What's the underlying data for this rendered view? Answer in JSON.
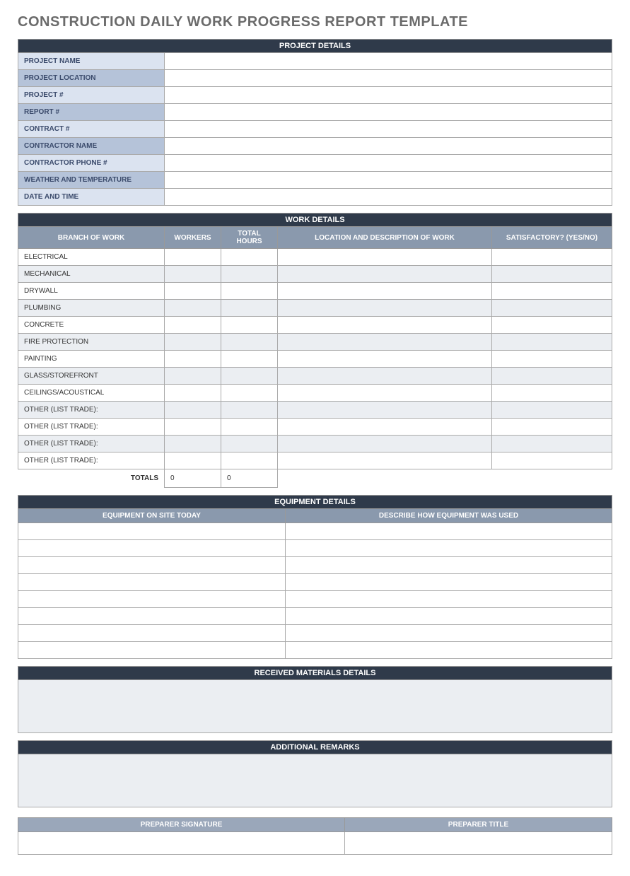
{
  "title": "CONSTRUCTION DAILY WORK PROGRESS REPORT TEMPLATE",
  "project": {
    "section_title": "PROJECT DETAILS",
    "rows": [
      {
        "label": "PROJECT NAME",
        "value": ""
      },
      {
        "label": "PROJECT LOCATION",
        "value": ""
      },
      {
        "label": "PROJECT #",
        "value": ""
      },
      {
        "label": "REPORT #",
        "value": ""
      },
      {
        "label": "CONTRACT #",
        "value": ""
      },
      {
        "label": "CONTRACTOR NAME",
        "value": ""
      },
      {
        "label": "CONTRACTOR PHONE #",
        "value": ""
      },
      {
        "label": "WEATHER AND TEMPERATURE",
        "value": ""
      },
      {
        "label": "DATE AND TIME",
        "value": ""
      }
    ]
  },
  "work": {
    "section_title": "WORK DETAILS",
    "headers": {
      "branch": "BRANCH OF WORK",
      "workers": "WORKERS",
      "hours": "TOTAL HOURS",
      "loc": "LOCATION AND DESCRIPTION OF WORK",
      "sat": "SATISFACTORY? (YES/NO)"
    },
    "rows": [
      {
        "branch": "ELECTRICAL",
        "workers": "",
        "hours": "",
        "loc": "",
        "sat": ""
      },
      {
        "branch": "MECHANICAL",
        "workers": "",
        "hours": "",
        "loc": "",
        "sat": ""
      },
      {
        "branch": "DRYWALL",
        "workers": "",
        "hours": "",
        "loc": "",
        "sat": ""
      },
      {
        "branch": "PLUMBING",
        "workers": "",
        "hours": "",
        "loc": "",
        "sat": ""
      },
      {
        "branch": "CONCRETE",
        "workers": "",
        "hours": "",
        "loc": "",
        "sat": ""
      },
      {
        "branch": "FIRE PROTECTION",
        "workers": "",
        "hours": "",
        "loc": "",
        "sat": ""
      },
      {
        "branch": "PAINTING",
        "workers": "",
        "hours": "",
        "loc": "",
        "sat": ""
      },
      {
        "branch": "GLASS/STOREFRONT",
        "workers": "",
        "hours": "",
        "loc": "",
        "sat": ""
      },
      {
        "branch": "CEILINGS/ACOUSTICAL",
        "workers": "",
        "hours": "",
        "loc": "",
        "sat": ""
      },
      {
        "branch": "OTHER (LIST TRADE):",
        "workers": "",
        "hours": "",
        "loc": "",
        "sat": ""
      },
      {
        "branch": "OTHER (LIST TRADE):",
        "workers": "",
        "hours": "",
        "loc": "",
        "sat": ""
      },
      {
        "branch": "OTHER (LIST TRADE):",
        "workers": "",
        "hours": "",
        "loc": "",
        "sat": ""
      },
      {
        "branch": "OTHER (LIST TRADE):",
        "workers": "",
        "hours": "",
        "loc": "",
        "sat": ""
      }
    ],
    "totals_label": "TOTALS",
    "totals_workers": "0",
    "totals_hours": "0"
  },
  "equipment": {
    "section_title": "EQUIPMENT DETAILS",
    "headers": {
      "onsite": "EQUIPMENT ON SITE TODAY",
      "used": "DESCRIBE HOW EQUIPMENT WAS USED"
    },
    "rows": [
      {
        "onsite": "",
        "used": ""
      },
      {
        "onsite": "",
        "used": ""
      },
      {
        "onsite": "",
        "used": ""
      },
      {
        "onsite": "",
        "used": ""
      },
      {
        "onsite": "",
        "used": ""
      },
      {
        "onsite": "",
        "used": ""
      },
      {
        "onsite": "",
        "used": ""
      },
      {
        "onsite": "",
        "used": ""
      }
    ]
  },
  "materials": {
    "section_title": "RECEIVED MATERIALS DETAILS",
    "value": ""
  },
  "remarks": {
    "section_title": "ADDITIONAL REMARKS",
    "value": ""
  },
  "signoff": {
    "sig_label": "PREPARER SIGNATURE",
    "title_label": "PREPARER TITLE",
    "sig_value": "",
    "title_value": ""
  }
}
